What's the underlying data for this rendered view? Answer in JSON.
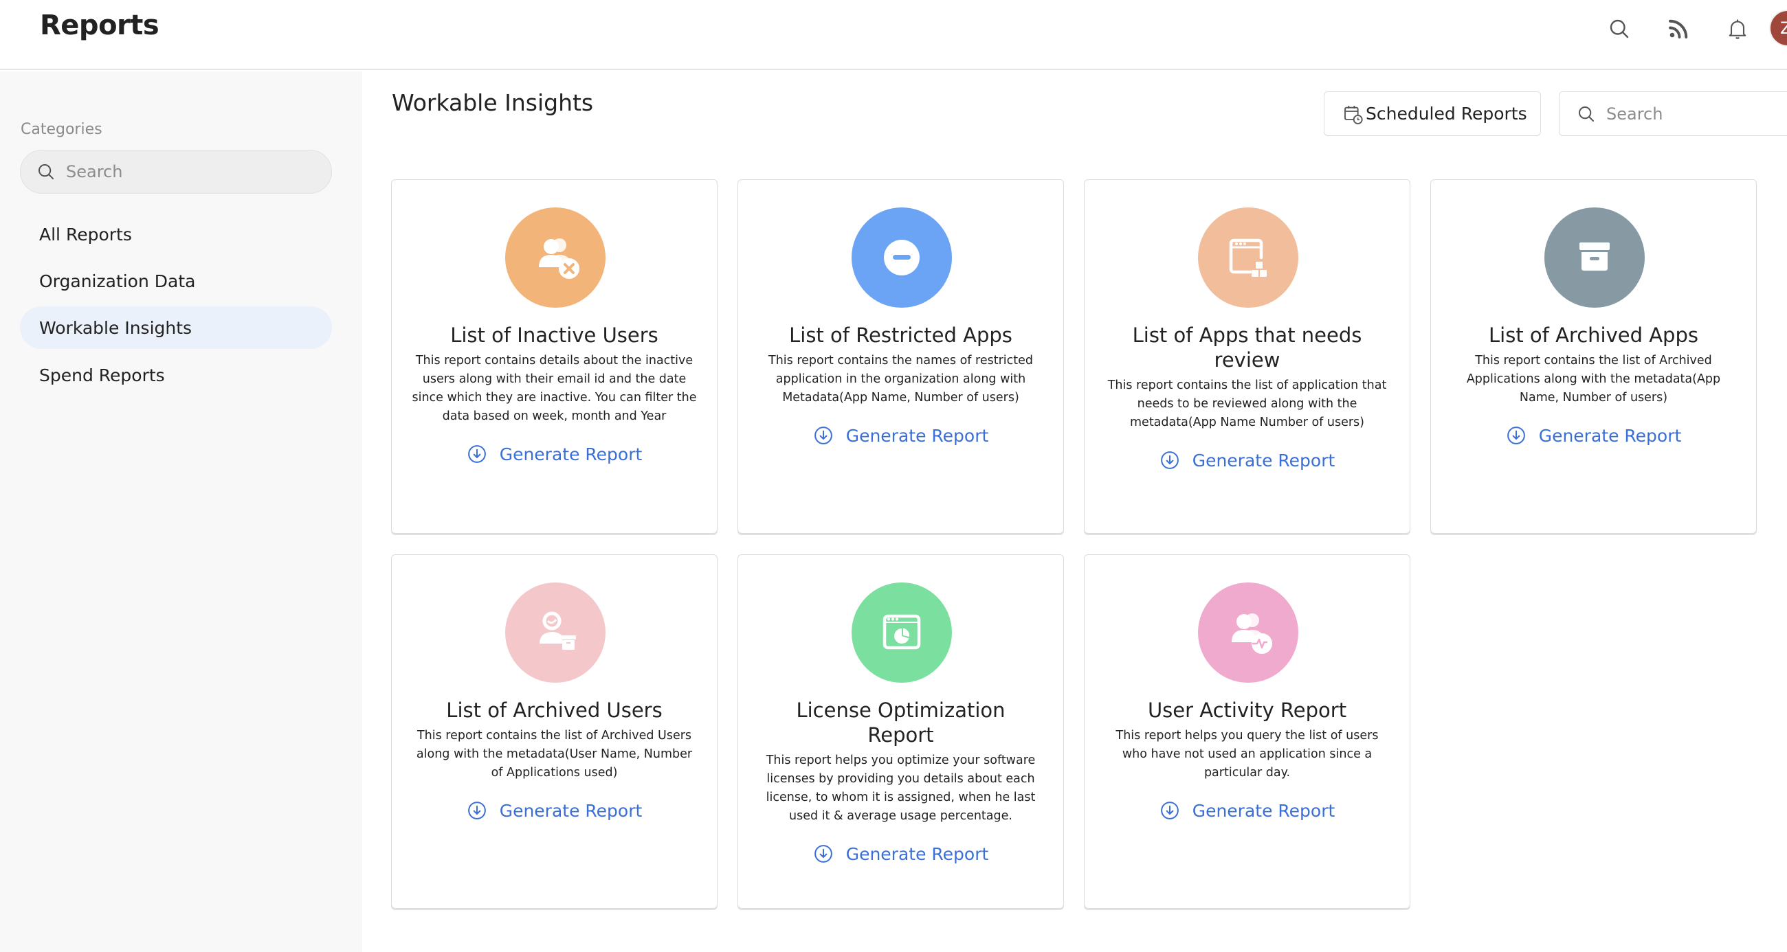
{
  "header": {
    "title": "Reports",
    "icons": [
      "search-icon",
      "rss-feed-icon",
      "bell-icon"
    ],
    "avatar_initial": "Z",
    "avatar_color": "#a0473c"
  },
  "sidebar": {
    "section_label": "Categories",
    "search_placeholder": "Search",
    "items": [
      {
        "label": "All Reports",
        "active": false
      },
      {
        "label": "Organization Data",
        "active": false
      },
      {
        "label": "Workable Insights",
        "active": true
      },
      {
        "label": "Spend Reports",
        "active": false
      }
    ]
  },
  "main": {
    "title": "Workable Insights",
    "scheduled_reports_label": "Scheduled Reports",
    "search_placeholder": "Search",
    "generate_label": "Generate Report",
    "accent_color": "#3a6fd8",
    "cards": [
      {
        "title": "List of Inactive Users",
        "icon": "inactive-users-icon",
        "color": "#f2b478",
        "description": "This report contains details about the inactive users along with their email id and the date since which they are inactive. You can filter the data based on week, month and Year"
      },
      {
        "title": "List of Restricted Apps",
        "icon": "restricted-icon",
        "color": "#6ba4f5",
        "description": "This report contains the names of restricted application in the organization along with Metadata(App Name, Number of users)"
      },
      {
        "title": "List of Apps that needs review",
        "icon": "app-review-icon",
        "color": "#f2bd9a",
        "description": "This report contains the list of application that needs to be reviewed along with the metadata(App Name Number of users)"
      },
      {
        "title": "List of Archived Apps",
        "icon": "archive-box-icon",
        "color": "#8799a3",
        "description": "This report contains the list of Archived Applications along with the metadata(App Name, Number of users)"
      },
      {
        "title": "List of Archived Users",
        "icon": "archived-user-icon",
        "color": "#f4c8cb",
        "description": "This report contains the list of Archived Users along with the metadata(User Name, Number of Applications used)"
      },
      {
        "title": "License Optimization Report",
        "icon": "license-optimization-icon",
        "color": "#7adf9f",
        "description": "This report helps you optimize your software licenses by providing you details about each license, to whom it is assigned, when he last used it & average usage percentage."
      },
      {
        "title": "User Activity Report",
        "icon": "user-activity-icon",
        "color": "#f0aacd",
        "description": "This report helps you query the list of users who have not used an application since a particular day."
      }
    ]
  }
}
